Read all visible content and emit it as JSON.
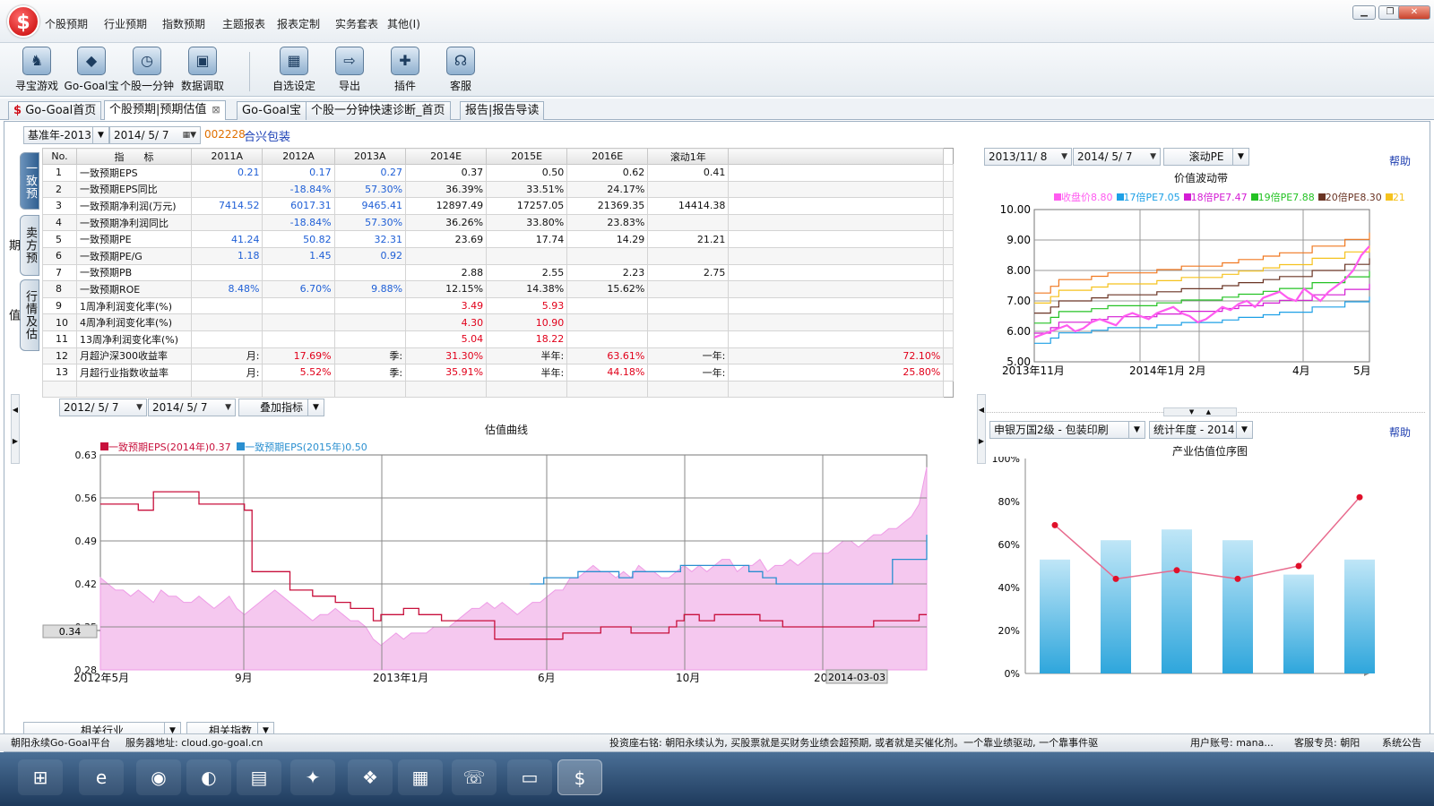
{
  "app": {
    "logo": "$"
  },
  "menu": [
    "个股预期",
    "行业预期",
    "指数预期",
    "主题报表",
    "报表定制",
    "实务套表",
    "其他(I)"
  ],
  "window_buttons": {
    "minimize": "▁",
    "restore": "❐",
    "close": "✕"
  },
  "toolbar": [
    {
      "label": "寻宝游戏",
      "icon": "game-icon",
      "glyph": "♞"
    },
    {
      "label": "Go-Goal宝",
      "icon": "diamond-icon",
      "glyph": "◆"
    },
    {
      "label": "个股一分钟",
      "icon": "stopwatch-icon",
      "glyph": "◷"
    },
    {
      "label": "数据调取",
      "icon": "camera-icon",
      "glyph": "▣"
    },
    {
      "label": "自选设定",
      "icon": "grid-icon",
      "glyph": "▦"
    },
    {
      "label": "导出",
      "icon": "export-icon",
      "glyph": "⇨"
    },
    {
      "label": "插件",
      "icon": "puzzle-icon",
      "glyph": "✚"
    },
    {
      "label": "客服",
      "icon": "headset-icon",
      "glyph": "☊"
    }
  ],
  "tabs": [
    {
      "label": "Go-Goal首页",
      "icon": "$"
    },
    {
      "label": "个股预期|预期估值",
      "close": "⊠"
    },
    {
      "label": "Go-Goal宝"
    },
    {
      "label": "个股一分钟快速诊断_首页"
    },
    {
      "label": "报告|报告导读"
    }
  ],
  "controls": {
    "base_year": "基准年-2013",
    "date": "2014/ 5/ 7",
    "stock_code": "002228",
    "stock_name": "合兴包装"
  },
  "side_tabs": [
    "一致预期",
    "卖方预期",
    "行情及估值"
  ],
  "table": {
    "headers": [
      "No.",
      "指　　标",
      "2011A",
      "2012A",
      "2013A",
      "2014E",
      "2015E",
      "2016E",
      "滚动1年",
      ""
    ],
    "rows": [
      {
        "no": "1",
        "name": "一致预期EPS",
        "v": [
          [
            "0.21",
            "blue"
          ],
          [
            "0.17",
            "blue"
          ],
          [
            "0.27",
            "blue"
          ],
          [
            "0.37",
            "blk"
          ],
          [
            "0.50",
            "blk"
          ],
          [
            "0.62",
            "blk"
          ],
          [
            "0.41",
            "blk"
          ],
          [
            "",
            ""
          ]
        ]
      },
      {
        "no": "2",
        "name": "一致预期EPS同比",
        "v": [
          [
            "",
            ""
          ],
          [
            "-18.84%",
            "blue"
          ],
          [
            "57.30%",
            "blue"
          ],
          [
            "36.39%",
            "blk"
          ],
          [
            "33.51%",
            "blk"
          ],
          [
            "24.17%",
            "blk"
          ],
          [
            "",
            ""
          ],
          [
            "",
            ""
          ]
        ]
      },
      {
        "no": "3",
        "name": "一致预期净利润(万元)",
        "v": [
          [
            "7414.52",
            "blue"
          ],
          [
            "6017.31",
            "blue"
          ],
          [
            "9465.41",
            "blue"
          ],
          [
            "12897.49",
            "blk"
          ],
          [
            "17257.05",
            "blk"
          ],
          [
            "21369.35",
            "blk"
          ],
          [
            "14414.38",
            "blk"
          ],
          [
            "",
            ""
          ]
        ]
      },
      {
        "no": "4",
        "name": "一致预期净利润同比",
        "v": [
          [
            "",
            ""
          ],
          [
            "-18.84%",
            "blue"
          ],
          [
            "57.30%",
            "blue"
          ],
          [
            "36.26%",
            "blk"
          ],
          [
            "33.80%",
            "blk"
          ],
          [
            "23.83%",
            "blk"
          ],
          [
            "",
            ""
          ],
          [
            "",
            ""
          ]
        ]
      },
      {
        "no": "5",
        "name": "一致预期PE",
        "v": [
          [
            "41.24",
            "blue"
          ],
          [
            "50.82",
            "blue"
          ],
          [
            "32.31",
            "blue"
          ],
          [
            "23.69",
            "blk"
          ],
          [
            "17.74",
            "blk"
          ],
          [
            "14.29",
            "blk"
          ],
          [
            "21.21",
            "blk"
          ],
          [
            "",
            ""
          ]
        ]
      },
      {
        "no": "6",
        "name": "一致预期PE/G",
        "v": [
          [
            "1.18",
            "blue"
          ],
          [
            "1.45",
            "blue"
          ],
          [
            "0.92",
            "blue"
          ],
          [
            "",
            ""
          ],
          [
            "",
            ""
          ],
          [
            "",
            ""
          ],
          [
            "",
            ""
          ],
          [
            "",
            ""
          ]
        ]
      },
      {
        "no": "7",
        "name": "一致预期PB",
        "v": [
          [
            "",
            ""
          ],
          [
            "",
            ""
          ],
          [
            "",
            ""
          ],
          [
            "2.88",
            "blk"
          ],
          [
            "2.55",
            "blk"
          ],
          [
            "2.23",
            "blk"
          ],
          [
            "2.75",
            "blk"
          ],
          [
            "",
            ""
          ]
        ]
      },
      {
        "no": "8",
        "name": "一致预期ROE",
        "v": [
          [
            "8.48%",
            "blue"
          ],
          [
            "6.70%",
            "blue"
          ],
          [
            "9.88%",
            "blue"
          ],
          [
            "12.15%",
            "blk"
          ],
          [
            "14.38%",
            "blk"
          ],
          [
            "15.62%",
            "blk"
          ],
          [
            "",
            ""
          ],
          [
            "",
            ""
          ]
        ]
      },
      {
        "no": "9",
        "name": "1周净利润变化率(%)",
        "v": [
          [
            "",
            ""
          ],
          [
            "",
            ""
          ],
          [
            "",
            ""
          ],
          [
            "3.49",
            "red"
          ],
          [
            "5.93",
            "red"
          ],
          [
            "",
            ""
          ],
          [
            "",
            ""
          ],
          [
            "",
            ""
          ]
        ]
      },
      {
        "no": "10",
        "name": "4周净利润变化率(%)",
        "v": [
          [
            "",
            ""
          ],
          [
            "",
            ""
          ],
          [
            "",
            ""
          ],
          [
            "4.30",
            "red"
          ],
          [
            "10.90",
            "red"
          ],
          [
            "",
            ""
          ],
          [
            "",
            ""
          ],
          [
            "",
            ""
          ]
        ]
      },
      {
        "no": "11",
        "name": "13周净利润变化率(%)",
        "v": [
          [
            "",
            ""
          ],
          [
            "",
            ""
          ],
          [
            "",
            ""
          ],
          [
            "5.04",
            "red"
          ],
          [
            "18.22",
            "red"
          ],
          [
            "",
            ""
          ],
          [
            "",
            ""
          ],
          [
            "",
            ""
          ]
        ]
      },
      {
        "no": "12",
        "name": "月超沪深300收益率",
        "v": [
          [
            "月:",
            "blk"
          ],
          [
            "17.69%",
            "red"
          ],
          [
            "季:",
            "blk"
          ],
          [
            "31.30%",
            "red"
          ],
          [
            "半年:",
            "blk"
          ],
          [
            "63.61%",
            "red"
          ],
          [
            "一年:",
            "blk"
          ],
          [
            "72.10%",
            "red"
          ]
        ]
      },
      {
        "no": "13",
        "name": "月超行业指数收益率",
        "v": [
          [
            "月:",
            "blk"
          ],
          [
            "5.52%",
            "red"
          ],
          [
            "季:",
            "blk"
          ],
          [
            "35.91%",
            "red"
          ],
          [
            "半年:",
            "blk"
          ],
          [
            "44.18%",
            "red"
          ],
          [
            "一年:",
            "blk"
          ],
          [
            "25.80%",
            "red"
          ]
        ]
      }
    ]
  },
  "valuation_controls": {
    "from": "2012/ 5/ 7",
    "to": "2014/ 5/ 7",
    "overlay": "叠加指标"
  },
  "band_controls": {
    "from": "2013/11/ 8",
    "to": "2014/ 5/ 7",
    "mode": "滚动PE",
    "help": "帮助"
  },
  "industry_controls": {
    "industry": "申银万国2级 - 包装印刷",
    "period": "统计年度 - 2014",
    "help": "帮助"
  },
  "bottom_buttons": {
    "industry": "相关行业",
    "index": "相关指数"
  },
  "colors": {
    "eps2014": "#c8103c",
    "eps2015": "#2a8fd0",
    "price_fill": "#f5c8ef",
    "price_line": "#ee9be6"
  },
  "chart_data": [
    {
      "type": "line",
      "title": "估值曲线",
      "x_ticks": [
        "2012年5月",
        "9月",
        "2013年1月",
        "6月",
        "10月",
        "201"
      ],
      "cursor_label": "2014-03-03",
      "cursor_value": "0.34",
      "y_ticks": [
        "0.63",
        "0.56",
        "0.49",
        "0.42",
        "0.35",
        "0.28"
      ],
      "ylim": [
        0.28,
        0.63
      ],
      "grid": true,
      "series": [
        {
          "name": "一致预期EPS(2014年)0.37",
          "color": "#c8103c",
          "values": [
            0.55,
            0.55,
            0.55,
            0.55,
            0.55,
            0.54,
            0.54,
            0.57,
            0.57,
            0.57,
            0.57,
            0.57,
            0.57,
            0.55,
            0.55,
            0.55,
            0.55,
            0.55,
            0.55,
            0.54,
            0.44,
            0.44,
            0.44,
            0.44,
            0.44,
            0.41,
            0.41,
            0.41,
            0.4,
            0.4,
            0.4,
            0.39,
            0.39,
            0.38,
            0.38,
            0.38,
            0.36,
            0.37,
            0.37,
            0.37,
            0.38,
            0.38,
            0.37,
            0.37,
            0.37,
            0.36,
            0.36,
            0.36,
            0.36,
            0.36,
            0.36,
            0.36,
            0.33,
            0.33,
            0.33,
            0.33,
            0.33,
            0.33,
            0.33,
            0.33,
            0.33,
            0.34,
            0.34,
            0.34,
            0.34,
            0.34,
            0.35,
            0.35,
            0.35,
            0.35,
            0.34,
            0.34,
            0.34,
            0.34,
            0.34,
            0.35,
            0.36,
            0.37,
            0.37,
            0.36,
            0.36,
            0.37,
            0.37,
            0.37,
            0.37,
            0.37,
            0.37,
            0.36,
            0.36,
            0.36,
            0.35,
            0.35,
            0.35,
            0.35,
            0.35,
            0.35,
            0.35,
            0.35,
            0.35,
            0.35,
            0.35,
            0.35,
            0.36,
            0.36,
            0.36,
            0.36,
            0.36,
            0.36,
            0.37,
            0.37
          ]
        },
        {
          "name": "一致预期EPS(2015年)0.50",
          "color": "#2a8fd0",
          "start": 0.52,
          "values": [
            0.42,
            0.42,
            0.43,
            0.43,
            0.43,
            0.43,
            0.43,
            0.44,
            0.44,
            0.44,
            0.44,
            0.44,
            0.44,
            0.43,
            0.43,
            0.44,
            0.44,
            0.44,
            0.44,
            0.44,
            0.44,
            0.44,
            0.45,
            0.45,
            0.45,
            0.45,
            0.45,
            0.45,
            0.45,
            0.45,
            0.45,
            0.45,
            0.44,
            0.44,
            0.43,
            0.43,
            0.42,
            0.42,
            0.42,
            0.42,
            0.42,
            0.42,
            0.42,
            0.42,
            0.42,
            0.42,
            0.42,
            0.42,
            0.42,
            0.42,
            0.42,
            0.42,
            0.42,
            0.46,
            0.46,
            0.46,
            0.46,
            0.46,
            0.5
          ]
        }
      ],
      "price_fill": [
        0.43,
        0.42,
        0.41,
        0.41,
        0.4,
        0.41,
        0.4,
        0.39,
        0.41,
        0.4,
        0.4,
        0.39,
        0.39,
        0.4,
        0.39,
        0.38,
        0.39,
        0.4,
        0.38,
        0.37,
        0.38,
        0.39,
        0.4,
        0.41,
        0.4,
        0.39,
        0.38,
        0.37,
        0.36,
        0.37,
        0.37,
        0.38,
        0.37,
        0.36,
        0.36,
        0.35,
        0.33,
        0.32,
        0.33,
        0.34,
        0.33,
        0.34,
        0.34,
        0.34,
        0.35,
        0.35,
        0.35,
        0.36,
        0.37,
        0.38,
        0.38,
        0.39,
        0.38,
        0.39,
        0.38,
        0.37,
        0.38,
        0.39,
        0.39,
        0.4,
        0.41,
        0.41,
        0.43,
        0.43,
        0.44,
        0.45,
        0.44,
        0.44,
        0.43,
        0.44,
        0.43,
        0.45,
        0.44,
        0.44,
        0.43,
        0.43,
        0.44,
        0.45,
        0.44,
        0.45,
        0.44,
        0.45,
        0.46,
        0.46,
        0.44,
        0.45,
        0.45,
        0.46,
        0.44,
        0.45,
        0.45,
        0.46,
        0.45,
        0.46,
        0.47,
        0.47,
        0.47,
        0.48,
        0.49,
        0.49,
        0.48,
        0.49,
        0.5,
        0.5,
        0.51,
        0.51,
        0.52,
        0.53,
        0.55,
        0.61
      ]
    },
    {
      "type": "line",
      "title": "价值波动带",
      "legend": [
        "收盘价8.80",
        "17倍PE7.05",
        "18倍PE7.47",
        "19倍PE7.88",
        "20倍PE8.30",
        "21"
      ],
      "legend_colors": [
        "#ff5bf0",
        "#1ea0e6",
        "#d41cd4",
        "#24c224",
        "#6a3424",
        "#f5c21e"
      ],
      "y_ticks": [
        "10.00",
        "9.00",
        "8.00",
        "7.00",
        "6.00",
        "5.00"
      ],
      "ylim": [
        5,
        10
      ],
      "x_ticks": [
        "2013年11月",
        "2014年1月",
        "2月",
        "4月",
        "5月"
      ],
      "grid": true,
      "band_multiples": [
        17,
        18,
        19,
        20,
        21,
        22
      ],
      "band_colors": [
        "#1ea0e6",
        "#d41cd4",
        "#24c224",
        "#6a3424",
        "#f5c21e",
        "#f07820"
      ],
      "eps_path": [
        0.33,
        0.33,
        0.34,
        0.35,
        0.35,
        0.35,
        0.35,
        0.355,
        0.355,
        0.36,
        0.36,
        0.36,
        0.36,
        0.36,
        0.36,
        0.365,
        0.365,
        0.365,
        0.37,
        0.37,
        0.37,
        0.37,
        0.37,
        0.375,
        0.375,
        0.38,
        0.38,
        0.38,
        0.385,
        0.385,
        0.39,
        0.39,
        0.39,
        0.39,
        0.4,
        0.4,
        0.4,
        0.4,
        0.41,
        0.41,
        0.41,
        0.42
      ],
      "close": [
        5.8,
        5.9,
        6.0,
        6.1,
        6.2,
        6.0,
        6.1,
        6.3,
        6.4,
        6.3,
        6.2,
        6.5,
        6.6,
        6.5,
        6.4,
        6.6,
        6.7,
        6.8,
        6.6,
        6.5,
        6.3,
        6.4,
        6.6,
        6.8,
        6.7,
        6.9,
        7.0,
        6.8,
        7.1,
        7.2,
        7.3,
        7.1,
        7.0,
        7.4,
        7.2,
        7.0,
        7.3,
        7.5,
        7.7,
        8.0,
        8.5,
        8.8
      ]
    },
    {
      "type": "bar",
      "title": "产业估值位序图",
      "y_ticks": [
        "100%",
        "80%",
        "60%",
        "40%",
        "20%",
        "0%"
      ],
      "ylim": [
        0,
        100
      ],
      "values": [
        53,
        62,
        67,
        62,
        46,
        53
      ],
      "line_values": [
        69,
        44,
        48,
        44,
        50,
        82
      ],
      "colors": {
        "bar": "#2ea6dc",
        "line": "#e86b8e",
        "point": "#e0102a"
      }
    }
  ],
  "status": {
    "platform": "朝阳永续Go-Goal平台",
    "server": "服务器地址: cloud.go-goal.cn",
    "motto": "投资座右铭: 朝阳永续认为, 买股票就是买财务业绩会超预期, 或者就是买催化剂。一个靠业绩驱动, 一个靠事件驱",
    "user": "用户账号: mana...",
    "service": "客服专员: 朝阳",
    "notice": "系统公告"
  },
  "taskbar": [
    {
      "icon": "start-icon",
      "glyph": "⊞"
    },
    {
      "icon": "ie-icon",
      "glyph": "e"
    },
    {
      "icon": "chrome-icon",
      "glyph": "◉"
    },
    {
      "icon": "firefox-icon",
      "glyph": "◐"
    },
    {
      "icon": "folder-icon",
      "glyph": "▤"
    },
    {
      "icon": "star-icon",
      "glyph": "✦"
    },
    {
      "icon": "windows-icon",
      "glyph": "❖"
    },
    {
      "icon": "notes-icon",
      "glyph": "▦"
    },
    {
      "icon": "chat-icon",
      "glyph": "☏"
    },
    {
      "icon": "monitor-icon",
      "glyph": "▭"
    },
    {
      "icon": "gogoal-icon",
      "glyph": "$"
    }
  ]
}
